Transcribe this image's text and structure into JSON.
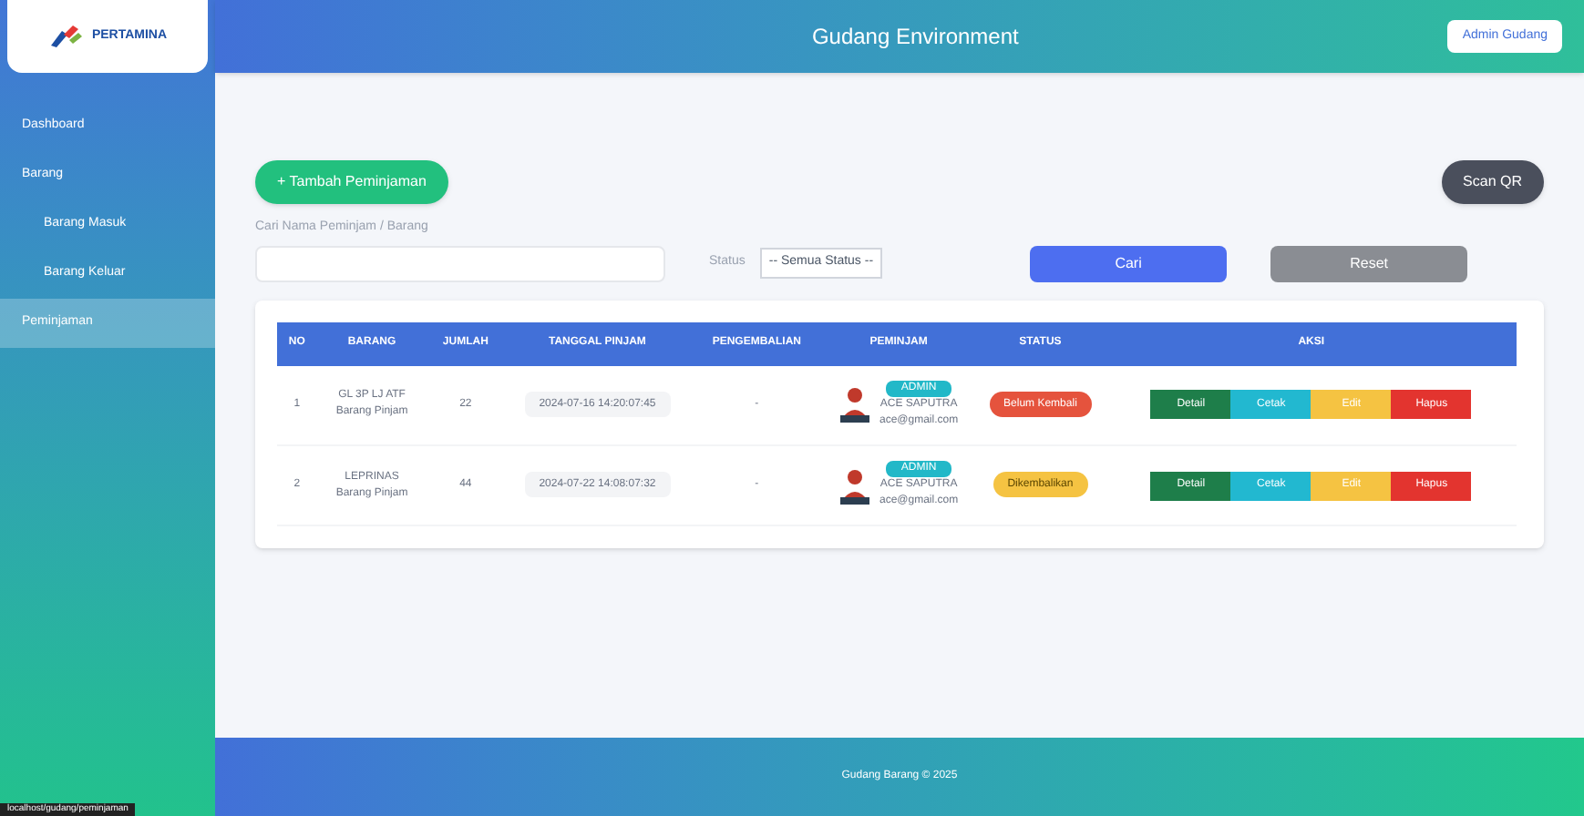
{
  "header": {
    "logo_text": "PERTAMINA",
    "title": "Gudang Environment",
    "user": "Admin Gudang"
  },
  "sidebar": {
    "items": [
      {
        "label": "Dashboard",
        "selected": false,
        "sub": false
      },
      {
        "label": "Barang",
        "selected": false,
        "sub": false
      },
      {
        "label": "Barang Masuk",
        "selected": false,
        "sub": true
      },
      {
        "label": "Barang Keluar",
        "selected": false,
        "sub": true
      },
      {
        "label": "Peminjaman",
        "selected": true,
        "sub": false
      }
    ]
  },
  "toolbar": {
    "add_button": "+ Tambah Peminjaman",
    "scan_button": "Scan QR",
    "search_label": "Cari Nama Peminjam / Barang",
    "status_label": "Status",
    "status_value": "-- Semua Status --",
    "search_button": "Cari",
    "reset_button": "Reset"
  },
  "table": {
    "columns": [
      "NO",
      "BARANG",
      "JUMLAH",
      "TANGGAL PINJAM",
      "PENGEMBALIAN",
      "PEMINJAM",
      "STATUS",
      "AKSI"
    ],
    "rows": [
      {
        "no": "1",
        "item": "GL 3P LJ ATF",
        "item_sub": "Barang Pinjam",
        "qty": "22",
        "date": "2024-07-16 14:20:07:45",
        "returned": "-",
        "role": "ADMIN",
        "borrower": "ACE SAPUTRA",
        "email": "ace@gmail.com",
        "status": "Belum Kembali",
        "kind": "pending",
        "actions": [
          "Detail",
          "Cetak",
          "Edit",
          "Hapus"
        ]
      },
      {
        "no": "2",
        "item": "LEPRINAS",
        "item_sub": "Barang Pinjam",
        "qty": "44",
        "date": "2024-07-22 14:08:07:32",
        "returned": "-",
        "role": "ADMIN",
        "borrower": "ACE SAPUTRA",
        "email": "ace@gmail.com",
        "status": "Dikembalikan",
        "kind": "returned",
        "actions": [
          "Detail",
          "Cetak",
          "Edit",
          "Hapus"
        ]
      }
    ]
  },
  "footer": "Gudang Barang © 2025",
  "status_tooltip": "localhost/gudang/peminjaman"
}
